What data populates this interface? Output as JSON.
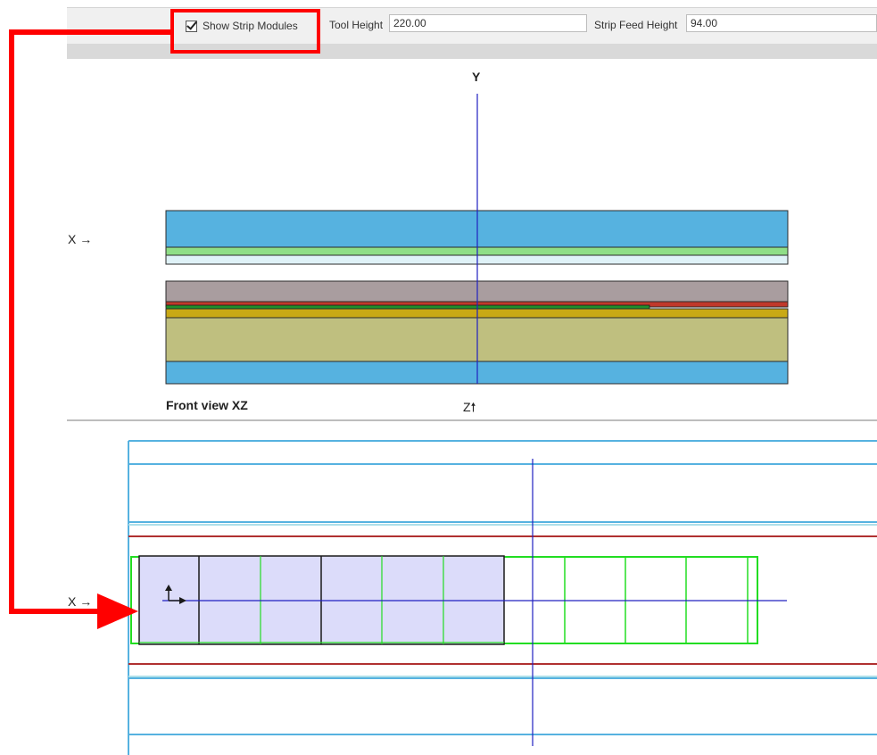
{
  "toolbar": {
    "show_strip_modules": {
      "label": "Show Strip Modules",
      "checked": true
    },
    "tool_height": {
      "label": "Tool Height",
      "value": "220.00"
    },
    "strip_feed_height": {
      "label": "Strip Feed Height",
      "value": "94.00"
    }
  },
  "front_view": {
    "title": "Front view XZ",
    "axis_y": "Y",
    "axis_x": "X →",
    "axis_z": "Z🠕"
  },
  "strip_view": {
    "axis_x": "X →"
  },
  "colors": {
    "upper_die_blue": "#56b2e0",
    "strip_green": "#8fde86",
    "stripper_gray": "#a99d9f",
    "red_plate": "#c0392b",
    "yellow_plate": "#c9a915",
    "olive_plate": "#bfbf7f",
    "axis_blue": "#2020c0",
    "module_fill": "#dcdcfa",
    "module_green": "#22dd22",
    "highlight_red": "#ff0000"
  }
}
